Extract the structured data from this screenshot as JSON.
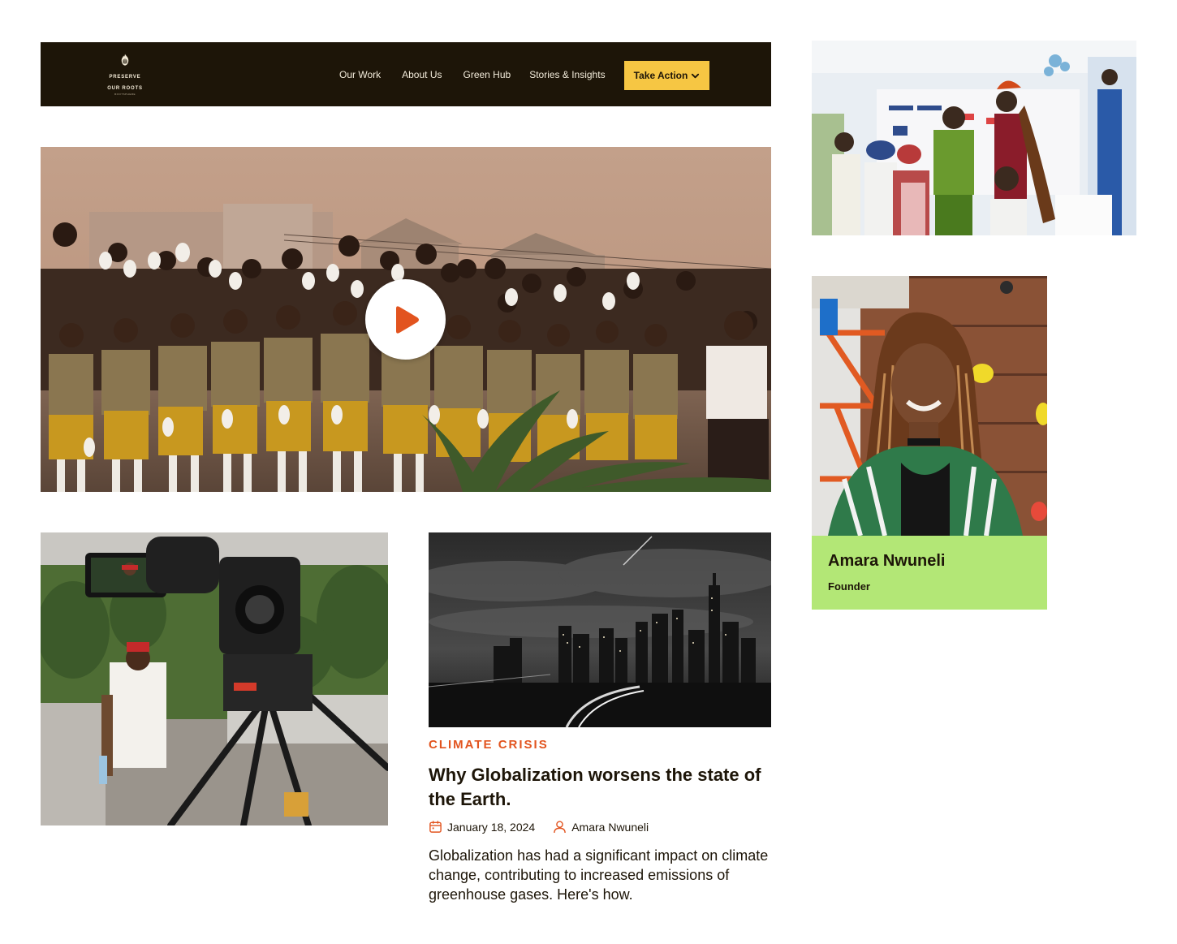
{
  "nav": {
    "logo": {
      "line1": "PRESERVE",
      "line2": "OUR ROOTS",
      "tagline": "ROOTSPHERE"
    },
    "links": [
      "Our Work",
      "About Us",
      "Green Hub",
      "Stories & Insights"
    ],
    "cta_label": "Take Action",
    "cta_icon": "chevron-down-icon"
  },
  "hero": {
    "play_icon": "play-icon"
  },
  "founder": {
    "name": "Amara Nwuneli",
    "role": "Founder"
  },
  "article": {
    "category": "CLIMATE CRISIS",
    "title": "Why Globalization worsens the state of the Earth.",
    "date": "January 18, 2024",
    "author": "Amara Nwuneli",
    "excerpt": "Globalization has had a significant impact on climate change, contributing to increased emissions of greenhouse gases. Here's how."
  },
  "colors": {
    "nav_bg": "#1d1508",
    "cta": "#f6c643",
    "accent_orange": "#e2541f",
    "founder_card": "#b3e776"
  }
}
